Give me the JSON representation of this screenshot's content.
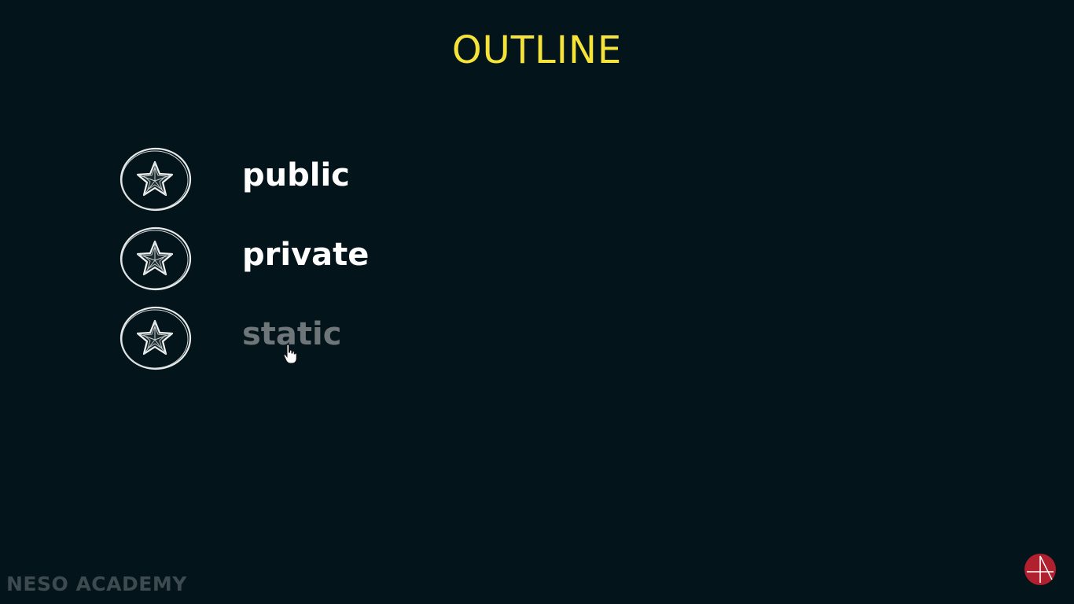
{
  "slide": {
    "title": "OUTLINE",
    "items": [
      {
        "label": "public",
        "icon": "star-badge-icon",
        "highlighted": true
      },
      {
        "label": "private",
        "icon": "star-badge-icon",
        "highlighted": true
      },
      {
        "label": "static",
        "icon": "star-badge-icon",
        "highlighted": false
      }
    ]
  },
  "watermark": {
    "text": "NESO ACADEMY"
  },
  "colors": {
    "background": "#03151b",
    "title": "#f5e33a",
    "active_text": "#ffffff",
    "dim_text": "#6e767a",
    "logo": "#b0202e"
  }
}
